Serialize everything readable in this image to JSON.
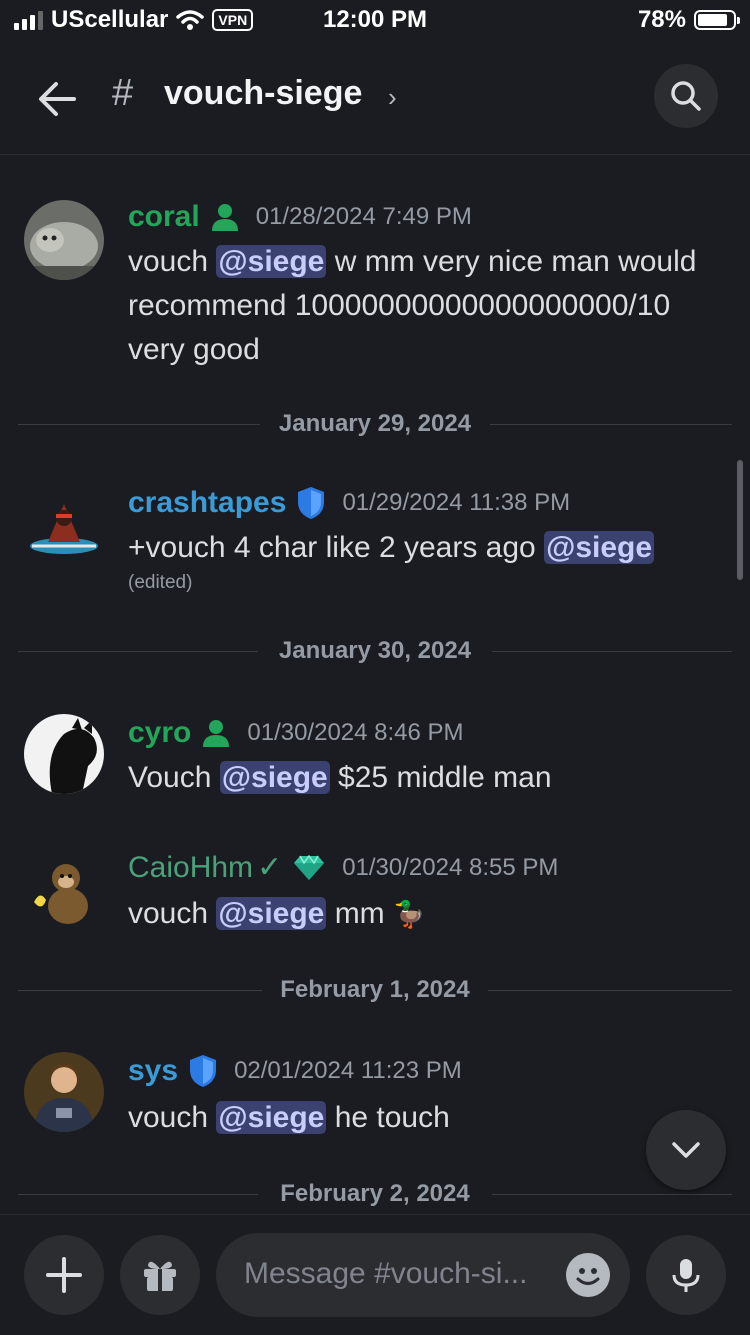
{
  "status_bar": {
    "carrier": "UScellular",
    "vpn": "VPN",
    "time": "12:00 PM",
    "battery": "78%"
  },
  "header": {
    "channel_name": "vouch-siege"
  },
  "messages": [
    {
      "username": "coral",
      "username_color": "#23a55a",
      "timestamp": "01/28/2024 7:49 PM",
      "pre": "vouch ",
      "mention": "@siege",
      "post": " w mm very nice man would recommend 10000000000000000000/10 very good"
    },
    {
      "username": "crashtapes",
      "username_color": "#3b9bd6",
      "timestamp": "01/29/2024 11:38 PM",
      "pre": "+vouch 4 char like 2 years ago ",
      "mention": "@siege",
      "post": "",
      "edited": "(edited)"
    },
    {
      "username": "cyro",
      "username_color": "#23a55a",
      "timestamp": "01/30/2024 8:46 PM",
      "pre": "Vouch ",
      "mention": "@siege",
      "post": " $25 middle man"
    },
    {
      "username": "CaioHhm",
      "username_color": "#4aa27a",
      "verified_mark": "✓",
      "timestamp": "01/30/2024 8:55 PM",
      "pre": "vouch ",
      "mention": "@siege",
      "post": " mm ",
      "emoji": "🦆"
    },
    {
      "username": "sys",
      "username_color": "#3b9bd6",
      "timestamp": "02/01/2024 11:23 PM",
      "pre": "vouch ",
      "mention": "@siege",
      "post": " he touch"
    }
  ],
  "dividers": [
    "January 29, 2024",
    "January 30, 2024",
    "February 1, 2024",
    "February 2, 2024"
  ],
  "composer": {
    "placeholder": "Message #vouch-si..."
  },
  "colors": {
    "background": "#1b1c21",
    "mention_bg": "#3c4270",
    "mention_text": "#c9cdfb",
    "shield": "#2c7be5",
    "gem": "#2ec4a0"
  }
}
